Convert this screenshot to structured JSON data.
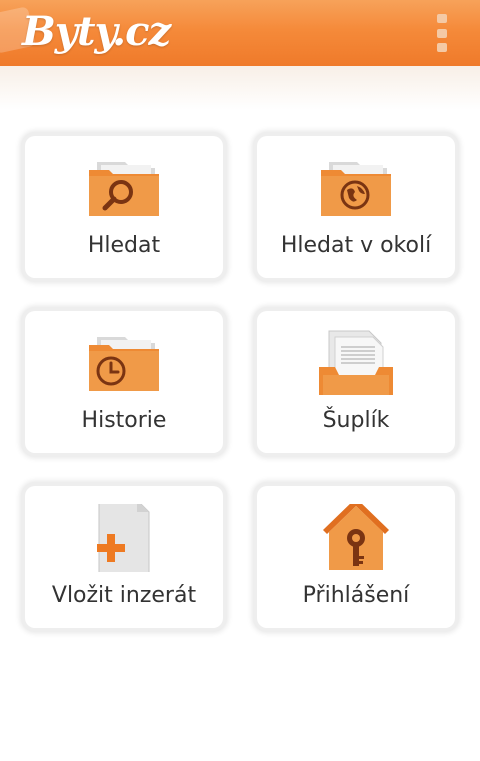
{
  "app": {
    "logo": "Byty.cz",
    "menu_icon": "overflow-menu-icon"
  },
  "colors": {
    "brand": "#f58a3a",
    "tile_text": "#333333"
  },
  "tiles": [
    {
      "label": "Hledat",
      "icon": "search-folder-icon"
    },
    {
      "label": "Hledat v okolí",
      "icon": "globe-folder-icon"
    },
    {
      "label": "Historie",
      "icon": "clock-folder-icon"
    },
    {
      "label": "Šuplík",
      "icon": "drawer-documents-icon"
    },
    {
      "label": "Vložit inzerát",
      "icon": "add-document-icon"
    },
    {
      "label": "Přihlášení",
      "icon": "house-key-icon"
    }
  ]
}
